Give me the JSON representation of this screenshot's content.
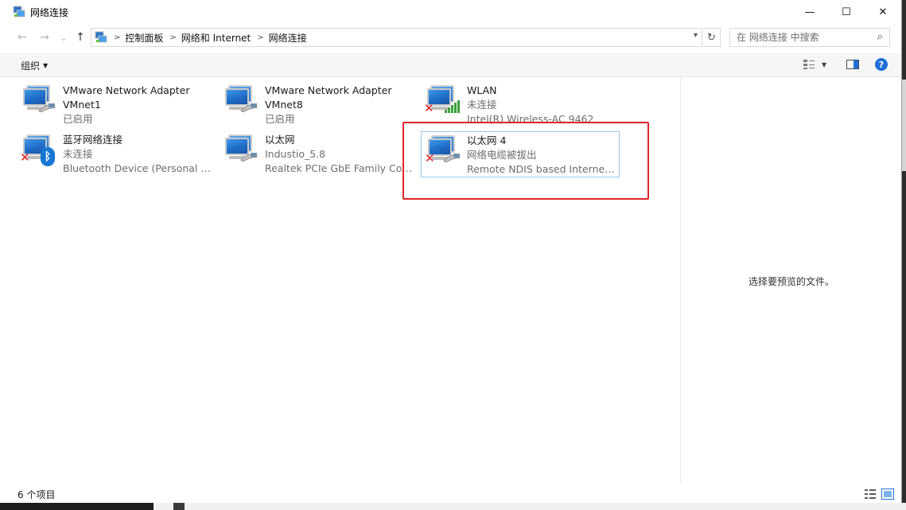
{
  "window": {
    "title": "网络连接",
    "controls": {
      "minimize": "—",
      "maximize": "☐",
      "close": "✕"
    }
  },
  "nav": {
    "back": "←",
    "forward": "→",
    "recent": "⌄",
    "up": "↑"
  },
  "address": {
    "crumbs": [
      "控制面板",
      "网络和 Internet",
      "网络连接"
    ],
    "separator": ">"
  },
  "search": {
    "placeholder": "在 网络连接 中搜索"
  },
  "toolbar": {
    "organize_label": "组织",
    "organize_caret": "▼",
    "help_label": "?"
  },
  "items": [
    {
      "name": "VMware Network Adapter",
      "line2": "VMnet1",
      "line3": "已启用",
      "icon": "network-monitor-icon",
      "badge": "cable-icon",
      "selected": false
    },
    {
      "name": "VMware Network Adapter",
      "line2": "VMnet8",
      "line3": "已启用",
      "icon": "network-monitor-icon",
      "badge": "cable-icon",
      "selected": false
    },
    {
      "name": "WLAN",
      "line2": "未连接",
      "line3": "Intel(R) Wireless-AC 9462",
      "icon": "network-monitor-icon",
      "badge": "wifi-signal-icon",
      "disconnected": true,
      "selected": false
    },
    {
      "name": "蓝牙网络连接",
      "line2": "未连接",
      "line3": "Bluetooth Device (Personal Ar...",
      "icon": "network-monitor-icon",
      "badge": "bluetooth-icon",
      "disconnected": true,
      "selected": false
    },
    {
      "name": "以太网",
      "line2": "Industio_5.8",
      "line3": "Realtek PCIe GbE Family Cont...",
      "icon": "network-monitor-icon",
      "badge": "cable-icon",
      "selected": false
    },
    {
      "name": "以太网 4",
      "line2": "网络电缆被拔出",
      "line3": "Remote NDIS based Internet ...",
      "icon": "network-monitor-icon",
      "badge": "cable-icon",
      "disconnected": true,
      "selected": true
    }
  ],
  "preview": {
    "empty_text": "选择要预览的文件。"
  },
  "status": {
    "count_text": "6 个项目"
  },
  "colors": {
    "highlight": "#e0252b",
    "accent": "#1e6fd9",
    "selection_border": "#99c9ef"
  }
}
